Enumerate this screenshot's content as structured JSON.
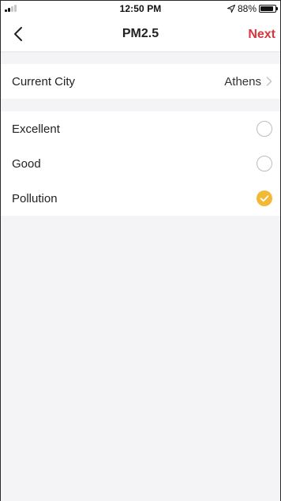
{
  "status_bar": {
    "time": "12:50 PM",
    "battery_text": "88%",
    "icons": [
      "signal-icon",
      "location-icon",
      "battery-icon"
    ]
  },
  "nav": {
    "title": "PM2.5",
    "next_label": "Next",
    "back_icon": "chevron-left-icon"
  },
  "city_row": {
    "label": "Current City",
    "value": "Athens"
  },
  "options": [
    {
      "label": "Excellent",
      "selected": false
    },
    {
      "label": "Good",
      "selected": false
    },
    {
      "label": "Pollution",
      "selected": true
    }
  ],
  "colors": {
    "accent_next": "#d9363e",
    "check_selected": "#f2b935",
    "background": "#f4f4f6"
  }
}
